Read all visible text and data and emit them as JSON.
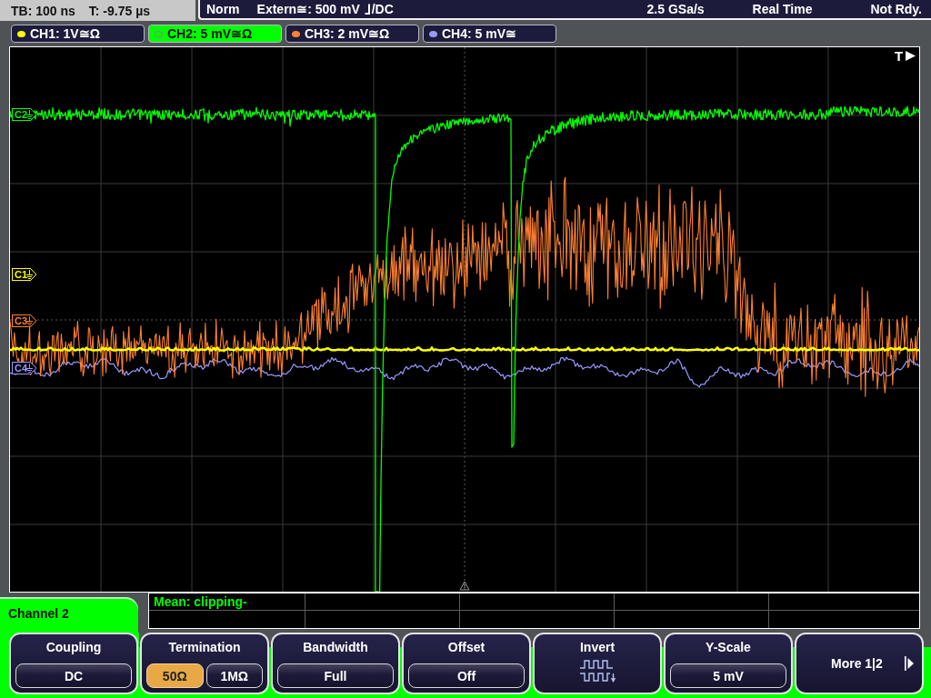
{
  "header": {
    "timebase": "TB: 100 ns",
    "trigger_time": "T: -9.75 µs",
    "trigger_mode": "Norm",
    "trigger_source": "Extern≅: 500 mV",
    "trigger_coupling": "/DC",
    "sample_rate": "2.5 GSa/s",
    "acquisition_mode": "Real Time",
    "status": "Not Rdy."
  },
  "channels": [
    {
      "label": "CH1: 1V≅Ω",
      "color": "#ffff00",
      "selected": false
    },
    {
      "label": "CH2: 5 mV≅Ω",
      "color": "#00ff00",
      "selected": true
    },
    {
      "label": "CH3: 2 mV≅Ω",
      "color": "#ff8030",
      "selected": false
    },
    {
      "label": "CH4: 5 mV≅",
      "color": "#9999ff",
      "selected": false
    }
  ],
  "plot": {
    "position_marker": "T",
    "markers": [
      {
        "label": "C2",
        "color": "#00ff00"
      },
      {
        "label": "C1",
        "color": "#ffff00"
      },
      {
        "label": "C3",
        "color": "#ff8030"
      },
      {
        "label": "C4",
        "color": "#9999ff"
      }
    ]
  },
  "menu": {
    "title": "Channel 2"
  },
  "measurement": {
    "readout": "Mean: clipping-"
  },
  "softkeys": [
    {
      "kind": "value",
      "label": "Coupling",
      "value": "DC"
    },
    {
      "kind": "choice",
      "label": "Termination",
      "options": [
        {
          "text": "50Ω",
          "selected": true
        },
        {
          "text": "1MΩ",
          "selected": false
        }
      ]
    },
    {
      "kind": "value",
      "label": "Bandwidth",
      "value": "Full"
    },
    {
      "kind": "value",
      "label": "Offset",
      "value": "Off"
    },
    {
      "kind": "icon",
      "label": "Invert"
    },
    {
      "kind": "value",
      "label": "Y-Scale",
      "value": "5 mV"
    },
    {
      "kind": "more",
      "label": "More 1|2"
    }
  ]
}
